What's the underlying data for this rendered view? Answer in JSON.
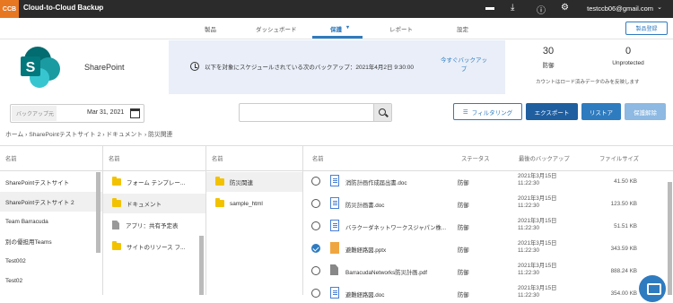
{
  "topbar": {
    "logo": "CCB",
    "app_name": "Cloud-to-Cloud Backup",
    "user": "testccb06@gmail.com",
    "icons": [
      "chat-icon",
      "download-icon",
      "help-icon",
      "gear-icon"
    ]
  },
  "nav": {
    "items": [
      "製品",
      "ダッシュボード",
      "保護",
      "レポート",
      "設定"
    ],
    "active": "保護",
    "register_label": "製品登録"
  },
  "hero": {
    "product": "SharePoint",
    "schedule_text": "以下を対象にスケジュールされている次のバックアップ：2021年4月2日 9:30:00",
    "backup_now_label": "今すぐバックアップ",
    "protected_count": "30",
    "protected_label": "防御",
    "unprotected_count": "0",
    "unprotected_label": "Unprotected",
    "note": "カウントはロード済みデータのみを反映します"
  },
  "toolbar": {
    "date_label": "バックアップ元",
    "date_value": "Mar 31, 2021",
    "search_value": "",
    "filter_label": "フィルタリング",
    "export_label": "エクスポート",
    "restore_label": "リストア",
    "unprotect_label": "保護解除"
  },
  "breadcrumb": "ホーム › SharePointテストサイト 2 › ドキュメント › 防災関連",
  "columns": {
    "c1": {
      "header": "名前",
      "items": [
        "SharePointテストサイト",
        "SharePointテストサイト 2",
        "Team Barracuda",
        "別の優担用Teams",
        "Test002",
        "Test02"
      ]
    },
    "c2": {
      "header": "名前",
      "items": [
        "フォーム テンプレー...",
        "ドキュメント",
        "アプリ：共有予定表",
        "サイトのリソース フ..."
      ]
    },
    "c3": {
      "header": "名前",
      "items": [
        "防災関連",
        "sample_html"
      ]
    }
  },
  "files": {
    "headers": {
      "name": "名前",
      "status": "ステータス",
      "last_backup": "最後のバックアップ",
      "size": "ファイルサイズ"
    },
    "rows": [
      {
        "name": "消防計画作成届出書.doc",
        "status": "防御",
        "date": "2021年3月15日",
        "time": "11:22:30",
        "size": "41.50 KB",
        "type": "doc",
        "checked": false
      },
      {
        "name": "防災計画書.doc",
        "status": "防御",
        "date": "2021年3月15日",
        "time": "11:22:30",
        "size": "123.50 KB",
        "type": "doc",
        "checked": false
      },
      {
        "name": "バラクーダネットワークスジャパン株...",
        "status": "防御",
        "date": "2021年3月15日",
        "time": "11:22:30",
        "size": "51.51 KB",
        "type": "doc",
        "checked": false
      },
      {
        "name": "避難経路図.pptx",
        "status": "防御",
        "date": "2021年3月15日",
        "time": "11:22:30",
        "size": "343.59 KB",
        "type": "ppt",
        "checked": true
      },
      {
        "name": "BarracudaNetworks防災計画.pdf",
        "status": "防御",
        "date": "2021年3月15日",
        "time": "11:22:30",
        "size": "888.24 KB",
        "type": "pdf",
        "checked": false
      },
      {
        "name": "避難経路図.doc",
        "status": "防御",
        "date": "2021年3月15日",
        "time": "11:22:30",
        "size": "354.00 KB",
        "type": "doc",
        "checked": false
      }
    ]
  },
  "colors": {
    "topbar": "#2b2b2b",
    "accent": "#2f7bbf",
    "export": "#1f5fa0",
    "restore": "#2f7bbf",
    "unprotect": "#8db9e2",
    "logo": "#e87722"
  }
}
